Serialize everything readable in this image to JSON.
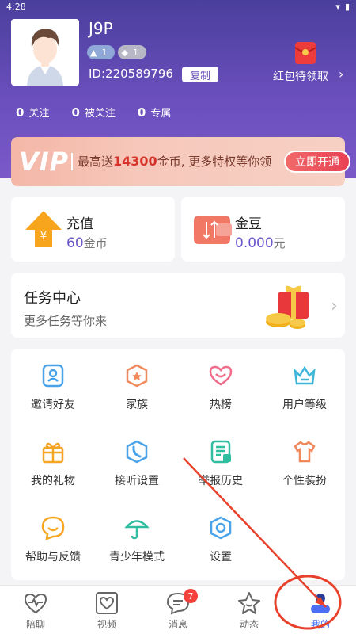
{
  "status": {
    "time": "4:28"
  },
  "profile": {
    "username": "J9P",
    "badge1": "1",
    "badge2": "1",
    "id_text": "ID:220589796",
    "copy_label": "复制"
  },
  "redpacket": {
    "label": "红包待领取"
  },
  "stats": [
    {
      "num": "0",
      "label": "关注"
    },
    {
      "num": "0",
      "label": "被关注"
    },
    {
      "num": "0",
      "label": "专属"
    }
  ],
  "vip": {
    "logo": "VIP",
    "text_prefix": "最高送",
    "amount": "14300",
    "text_suffix": "金币, 更多特权等你领",
    "button": "立即开通"
  },
  "wallet": {
    "recharge": {
      "title": "充值",
      "value": "60",
      "unit": "金币"
    },
    "beans": {
      "title": "金豆",
      "value": "0.000",
      "unit": "元"
    }
  },
  "task": {
    "title": "任务中心",
    "subtitle": "更多任务等你来"
  },
  "grid": [
    {
      "label": "邀请好友",
      "icon": "invite-icon"
    },
    {
      "label": "家族",
      "icon": "family-icon"
    },
    {
      "label": "热榜",
      "icon": "heart-icon"
    },
    {
      "label": "用户等级",
      "icon": "crown-icon"
    },
    {
      "label": "我的礼物",
      "icon": "gift-icon"
    },
    {
      "label": "接听设置",
      "icon": "phone-icon"
    },
    {
      "label": "举报历史",
      "icon": "report-icon"
    },
    {
      "label": "个性装扮",
      "icon": "shirt-icon"
    },
    {
      "label": "帮助与反馈",
      "icon": "help-icon"
    },
    {
      "label": "青少年模式",
      "icon": "umbrella-icon"
    },
    {
      "label": "设置",
      "icon": "settings-icon"
    }
  ],
  "tabs": [
    {
      "label": "陪聊",
      "icon": "heartbeat-icon"
    },
    {
      "label": "视频",
      "icon": "video-icon"
    },
    {
      "label": "消息",
      "icon": "message-icon",
      "badge": "7"
    },
    {
      "label": "动态",
      "icon": "star-icon"
    },
    {
      "label": "我的",
      "icon": "profile-icon"
    }
  ],
  "colors": {
    "accent": "#6b56c8",
    "tab_active": "#4b6ef5",
    "annotation": "#e8412c"
  }
}
